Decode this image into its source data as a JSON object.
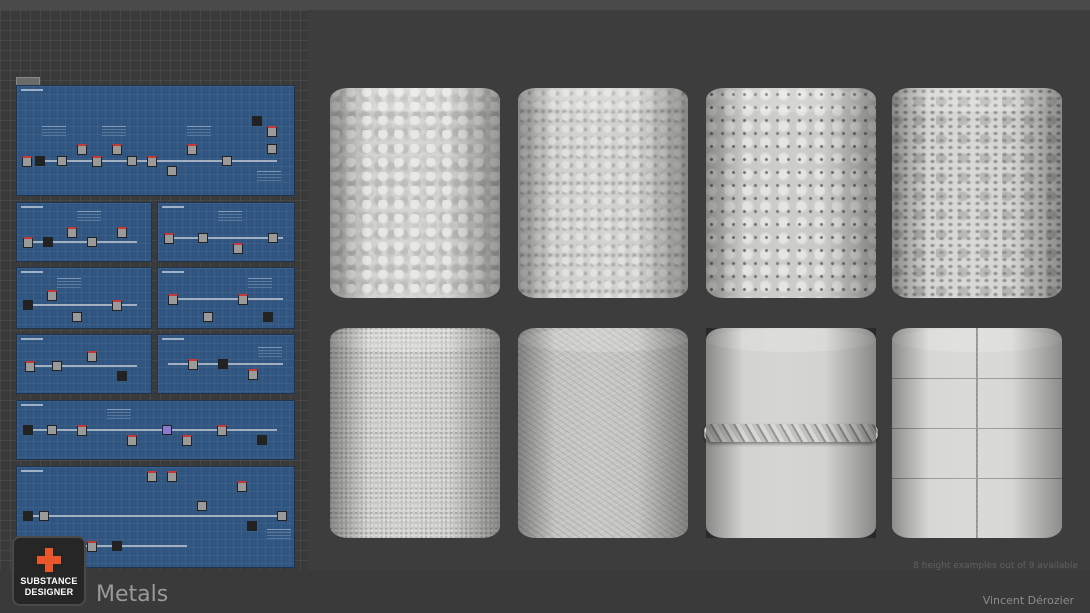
{
  "app": {
    "logo_line1": "SUBSTANCE",
    "logo_line2": "DESIGNER"
  },
  "page": {
    "title": "Metals",
    "author": "Vincent Dérozier"
  },
  "viewport": {
    "note": "8 height examples out of 9 available"
  },
  "colors": {
    "accent": "#e8562a",
    "frame_blue": "#2f5580",
    "background": "#3c3c3c"
  },
  "material_previews": [
    {
      "name": "bumpy-cylinder-1"
    },
    {
      "name": "bumpy-cylinder-2"
    },
    {
      "name": "speckled-cylinder"
    },
    {
      "name": "patchy-cylinder"
    },
    {
      "name": "fine-grain-cylinder"
    },
    {
      "name": "wrinkled-cylinder"
    },
    {
      "name": "weld-seam-cylinder"
    },
    {
      "name": "stitched-panel-cylinder"
    }
  ]
}
